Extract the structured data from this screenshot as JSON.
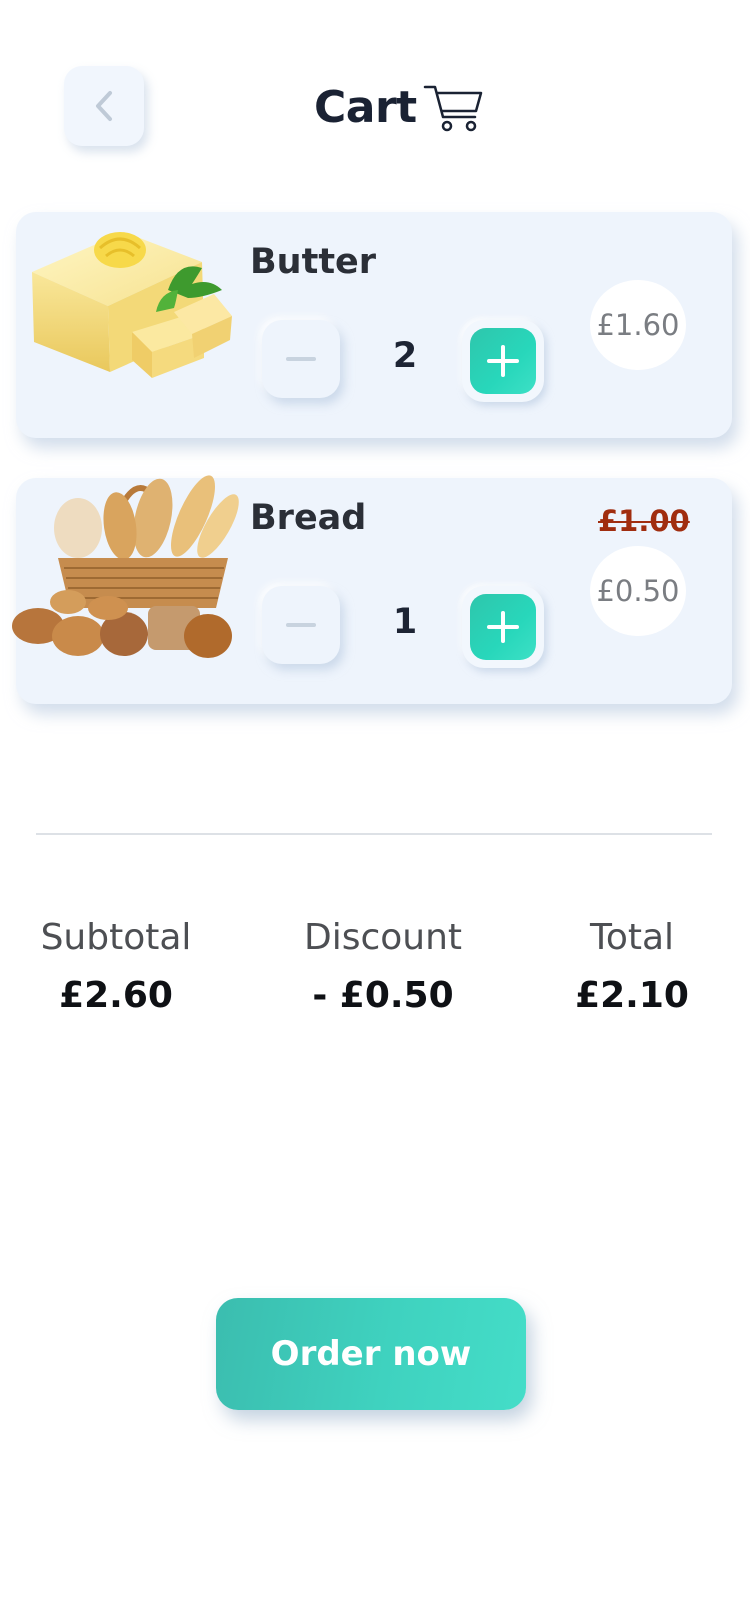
{
  "header": {
    "title": "Cart",
    "back_icon": "chevron-left-icon",
    "cart_icon": "shopping-cart-icon"
  },
  "items": [
    {
      "name": "Butter",
      "quantity": "2",
      "price": "£1.60",
      "old_price": null,
      "image": "butter-image"
    },
    {
      "name": "Bread",
      "quantity": "1",
      "price": "£0.50",
      "old_price": "£1.00",
      "image": "bread-basket-image"
    }
  ],
  "summary": {
    "subtotal_label": "Subtotal",
    "subtotal_value": "£2.60",
    "discount_label": "Discount",
    "discount_value": "- £0.50",
    "total_label": "Total",
    "total_value": "£2.10"
  },
  "order_button": {
    "label": "Order now"
  },
  "colors": {
    "accent": "#2ed3b7",
    "card_background": "#eef4fc",
    "discount_strike": "#a02d0f"
  }
}
